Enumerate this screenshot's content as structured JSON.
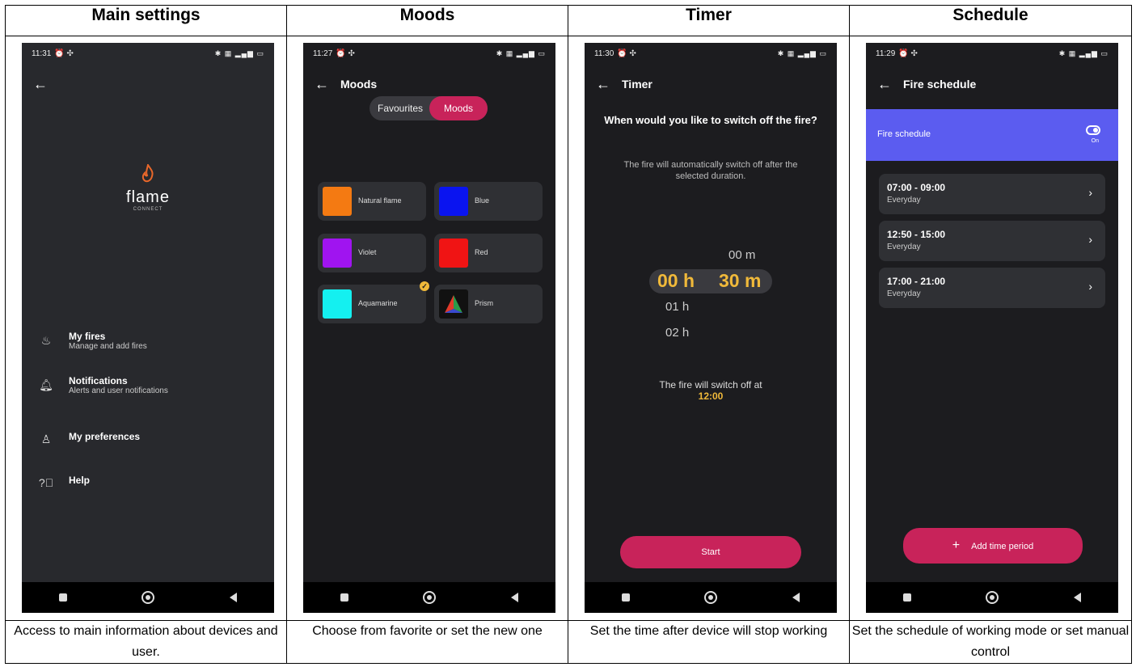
{
  "headers": [
    "Main settings",
    "Moods",
    "Timer",
    "Schedule"
  ],
  "captions": [
    "Access to main information about devices and user.",
    "Choose from favorite or set the new one",
    "Set the time after device will stop working",
    "Set the schedule of working mode or set manual control"
  ],
  "p1": {
    "time": "11:31",
    "back": "←",
    "logo_word": "flame",
    "logo_sub": "CONNECT",
    "items": [
      {
        "title": "My fires",
        "sub": "Manage and add fires",
        "icon": "flame-icon"
      },
      {
        "title": "Notifications",
        "sub": "Alerts and user notifications",
        "icon": "bell-icon"
      },
      {
        "title": "My preferences",
        "sub": "",
        "icon": "person-icon"
      },
      {
        "title": "Help",
        "sub": "",
        "icon": "help-icon"
      }
    ]
  },
  "p2": {
    "time": "11:27",
    "title": "Moods",
    "seg_a": "Favourites",
    "seg_b": "Moods",
    "moods": [
      {
        "name": "Natural flame",
        "color": "#f47a12"
      },
      {
        "name": "Blue",
        "color": "#0a14f0"
      },
      {
        "name": "Violet",
        "color": "#a014f0"
      },
      {
        "name": "Red",
        "color": "#f01414"
      },
      {
        "name": "Aquamarine",
        "color": "#14f0f0",
        "selected": true
      },
      {
        "name": "Prism",
        "color": "prism"
      }
    ]
  },
  "p3": {
    "time": "11:30",
    "title": "Timer",
    "question": "When would you like to switch off the fire?",
    "info": "The fire will automatically switch off after the selected duration.",
    "wheel_prev_m": "00 m",
    "sel_h": "00 h",
    "sel_m": "30 m",
    "next1": "01 h",
    "next2": "02 h",
    "off_label": "The fire will switch off at",
    "off_time": "12:00",
    "start": "Start"
  },
  "p4": {
    "time": "11:29",
    "title": "Fire schedule",
    "bar_label": "Fire schedule",
    "toggle_state": "On",
    "periods": [
      {
        "range": "07:00 - 09:00",
        "days": "Everyday"
      },
      {
        "range": "12:50 - 15:00",
        "days": "Everyday"
      },
      {
        "range": "17:00 - 21:00",
        "days": "Everyday"
      }
    ],
    "add": "Add time period"
  },
  "colors": {
    "accent": "#c8235a",
    "highlight": "#f0b93a",
    "schedule_bar": "#5b5cf0"
  }
}
